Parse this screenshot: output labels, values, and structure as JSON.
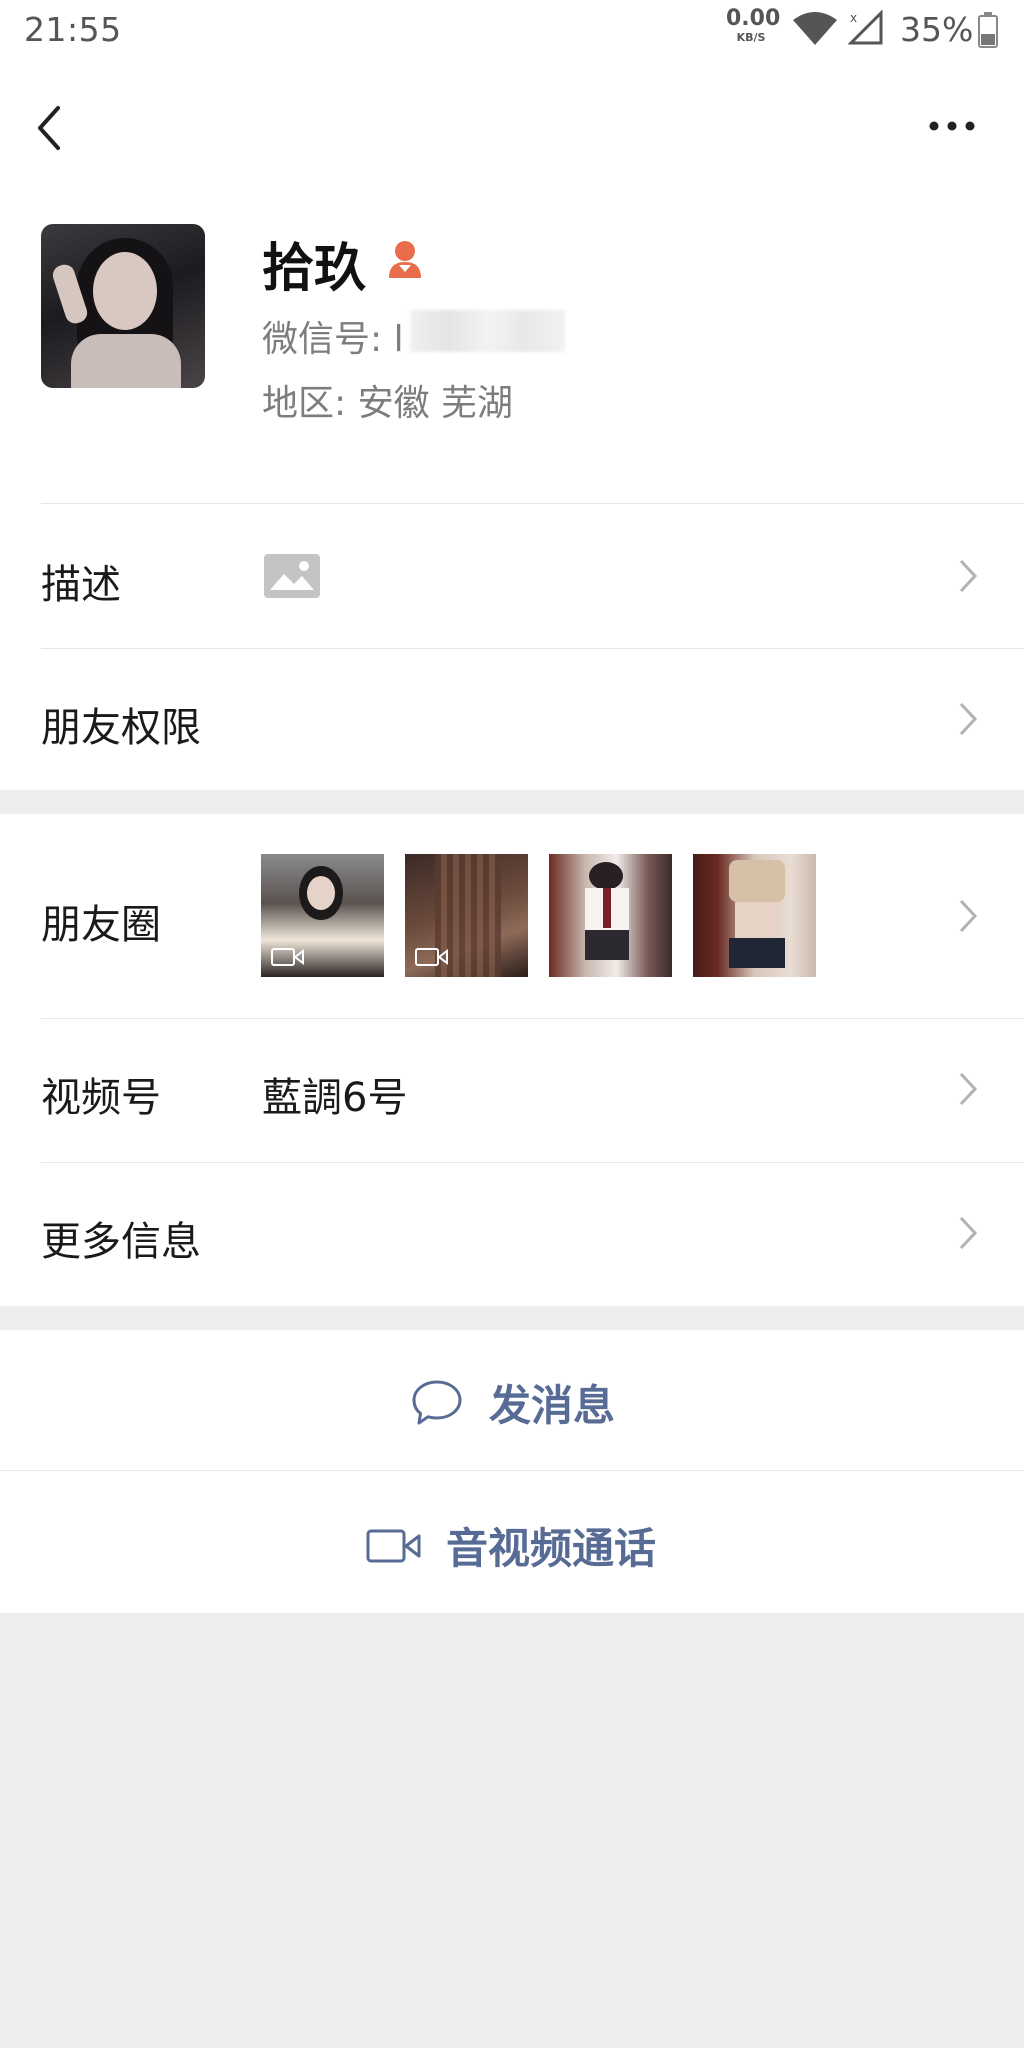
{
  "status_bar": {
    "time": "21:55",
    "net_speed": "0.00",
    "net_unit": "KB/S",
    "battery": "35%"
  },
  "profile": {
    "nickname": "拾玖",
    "wechat_id_label": "微信号: l",
    "region": "地区: 安徽  芜湖",
    "gender_icon_color": "#e96d4b"
  },
  "rows": {
    "description_label": "描述",
    "permissions_label": "朋友权限",
    "moments_label": "朋友圈",
    "channels_label": "视频号",
    "channels_value": "藍調6号",
    "more_info_label": "更多信息"
  },
  "moments_thumbnails": [
    {
      "icon": "photo",
      "video": true
    },
    {
      "icon": "photo",
      "video": true
    },
    {
      "icon": "photo",
      "video": false
    },
    {
      "icon": "photo",
      "video": false
    }
  ],
  "actions": {
    "message_label": "发消息",
    "call_label": "音视频通话",
    "accent_color": "#576b95"
  }
}
